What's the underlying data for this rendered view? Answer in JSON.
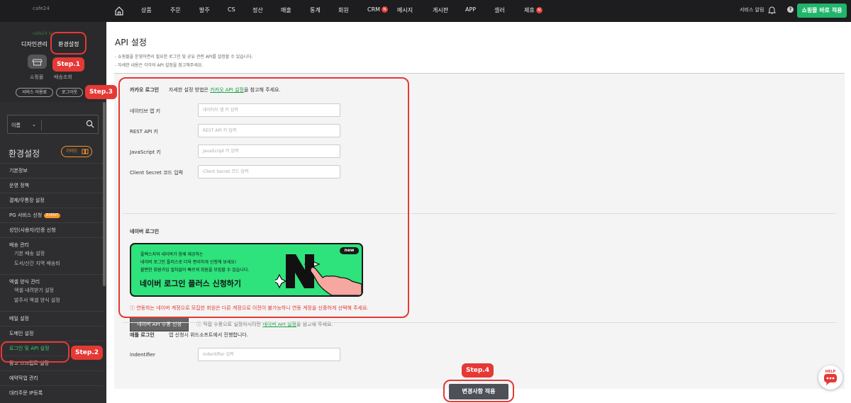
{
  "brand": {
    "logo_text": "cafe24"
  },
  "topnav": {
    "items": [
      {
        "label": "상품",
        "badge": ""
      },
      {
        "label": "주문",
        "badge": ""
      },
      {
        "label": "발주",
        "badge": ""
      },
      {
        "label": "CS",
        "badge": ""
      },
      {
        "label": "정산",
        "badge": ""
      },
      {
        "label": "매출",
        "badge": ""
      },
      {
        "label": "통계",
        "badge": ""
      },
      {
        "label": "회원",
        "badge": ""
      },
      {
        "label": "CRM",
        "badge": "N"
      },
      {
        "label": "메시지",
        "badge": ""
      },
      {
        "label": "게시판",
        "badge": ""
      },
      {
        "label": "APP",
        "badge": ""
      },
      {
        "label": "셀러",
        "badge": ""
      },
      {
        "label": "제휴",
        "badge": "N"
      }
    ],
    "alarm_label": "서비스 알림",
    "help_label": "?",
    "apply_shop_label": "쇼핑몰 바로 적용"
  },
  "sidebar": {
    "user_text": "cafe24 님",
    "tab_design": "디자인관리",
    "tab_settings": "환경설정",
    "shop_label": "쇼핑몰",
    "shipping_label": "배송조회",
    "service_btn": "서비스 이용료",
    "logout_btn": "로그아웃",
    "search_category": "이름",
    "search_placeholder": "",
    "section_title": "환경설정",
    "guide_label": "가이드",
    "menu": [
      {
        "label": "기본정보",
        "badge": "",
        "active": false,
        "subs": []
      },
      {
        "label": "운영 정책",
        "badge": "",
        "active": false,
        "subs": []
      },
      {
        "label": "결제/무통장 설정",
        "badge": "",
        "active": false,
        "subs": []
      },
      {
        "label": "PG 서비스 신청",
        "badge": "EVENT",
        "active": false,
        "subs": []
      },
      {
        "label": "성인(사용자)인증 신청",
        "badge": "",
        "active": false,
        "subs": []
      },
      {
        "label": "배송 관리",
        "badge": "",
        "active": false,
        "subs": [
          "기본 배송 설정",
          "도서/산간 지역 배송비"
        ]
      },
      {
        "label": "엑셀 양식 관리",
        "badge": "",
        "active": false,
        "subs": [
          "엑셀 내려받기 설정",
          "발주서 엑셀 양식 설정"
        ]
      },
      {
        "label": "메일 설정",
        "badge": "",
        "active": false,
        "subs": []
      },
      {
        "label": "도메인 설정",
        "badge": "",
        "active": false,
        "subs": []
      },
      {
        "label": "로그인 및 API 설정",
        "badge": "",
        "active": true,
        "subs": []
      },
      {
        "label": "광고 스크립트 설정",
        "badge": "",
        "active": false,
        "subs": []
      },
      {
        "label": "예약작업 관리",
        "badge": "",
        "active": false,
        "subs": []
      },
      {
        "label": "대리주문 IP등록",
        "badge": "",
        "active": false,
        "subs": []
      }
    ]
  },
  "main": {
    "title": "API 설정",
    "desc": [
      "- 쇼핑몰을 운영하면서 필요한 로그인 및 공유 관련 API를 설정할 수 있습니다.",
      "- 자세한 내용은 각각의 API 설정을 참고해주세요."
    ],
    "kakao": {
      "title": "카카오 로그인",
      "desc_prefix": "자세한 설정 방법은 ",
      "desc_link": "카카오 API 설정",
      "desc_suffix": "을 참고해 주세요.",
      "fields": [
        {
          "label": "네이티브 앱 키",
          "placeholder": "네이티브 앱 키 입력"
        },
        {
          "label": "REST API 키",
          "placeholder": "REST API 키 입력"
        },
        {
          "label": "JavaScript 키",
          "placeholder": "JavaScript 키 입력"
        },
        {
          "label": "Client Secret 코드 입력",
          "placeholder": "Client Secret 코드 입력"
        }
      ]
    },
    "naver": {
      "title": "네이버 로그인",
      "banner_lines": [
        "플렉스지와 네이버가 함께 제공하는",
        "네이버 로그인 플러스로 더욱 편리하게 신청해 보세요!",
        "불편한 회원가입 절차없이 빠르게 회원을 모집할 수 있습니다."
      ],
      "banner_cta": "네이버 로그인 플러스 신청하기",
      "banner_badge": "new",
      "warning": "ⓘ 연동하는 네이버 계정으로 모집한 회원은 다른 계정으로 이전이 불가능하니 연동 계정을 신중하게 선택해 주세요.",
      "manual_btn": "네이버 API 수동 신청",
      "note_prefix": "ⓘ 직접 수동으로 설정하시려면 ",
      "note_link": "네이버 API 설정",
      "note_suffix": "을 참고해 주세요."
    },
    "apple": {
      "title": "애플 로그인",
      "desc": "앱 신청시 위드소프트에서 진행합니다.",
      "field_label": "indentifier",
      "field_placeholder": "indentifier 입력"
    },
    "save_btn": "변경사항 적용"
  },
  "steps": [
    "Step.1",
    "Step.2",
    "Step.3",
    "Step.4"
  ],
  "help_bubble_label": "HELP",
  "colors": {
    "accent_green": "#1fb56a",
    "step_red": "#e53935",
    "banner_green": "#2ee27c",
    "topbar": "#1d1d1f",
    "sidebar": "#2e2e30"
  }
}
